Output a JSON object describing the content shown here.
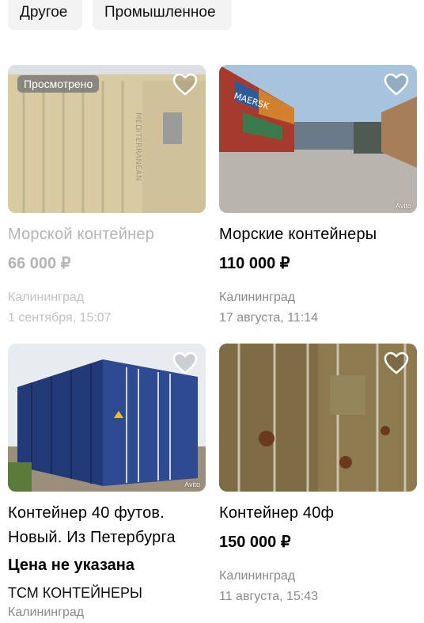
{
  "filters": [
    "Другое",
    "Промышленное"
  ],
  "viewed_badge": "Просмотрено",
  "watermark": "Avito",
  "listings": [
    {
      "title": "Морской контейнер",
      "price": "66 000 ₽",
      "city": "Калининград",
      "date": "1 сентября, 15:07",
      "viewed": true
    },
    {
      "title": "Морские контейнеры",
      "price": "110 000 ₽",
      "city": "Калининград",
      "date": "17 августа, 11:14"
    },
    {
      "title_line1": "Контейнер 40 футов.",
      "title_line2": "Новый. Из Петербурга",
      "price": "Цена не указана",
      "seller": "ТСМ КОНТЕЙНЕРЫ",
      "city": "Калининград"
    },
    {
      "title": "Контейнер 40ф",
      "price": "150 000 ₽",
      "city": "Калининград",
      "date": "11 августа, 15:43"
    }
  ]
}
